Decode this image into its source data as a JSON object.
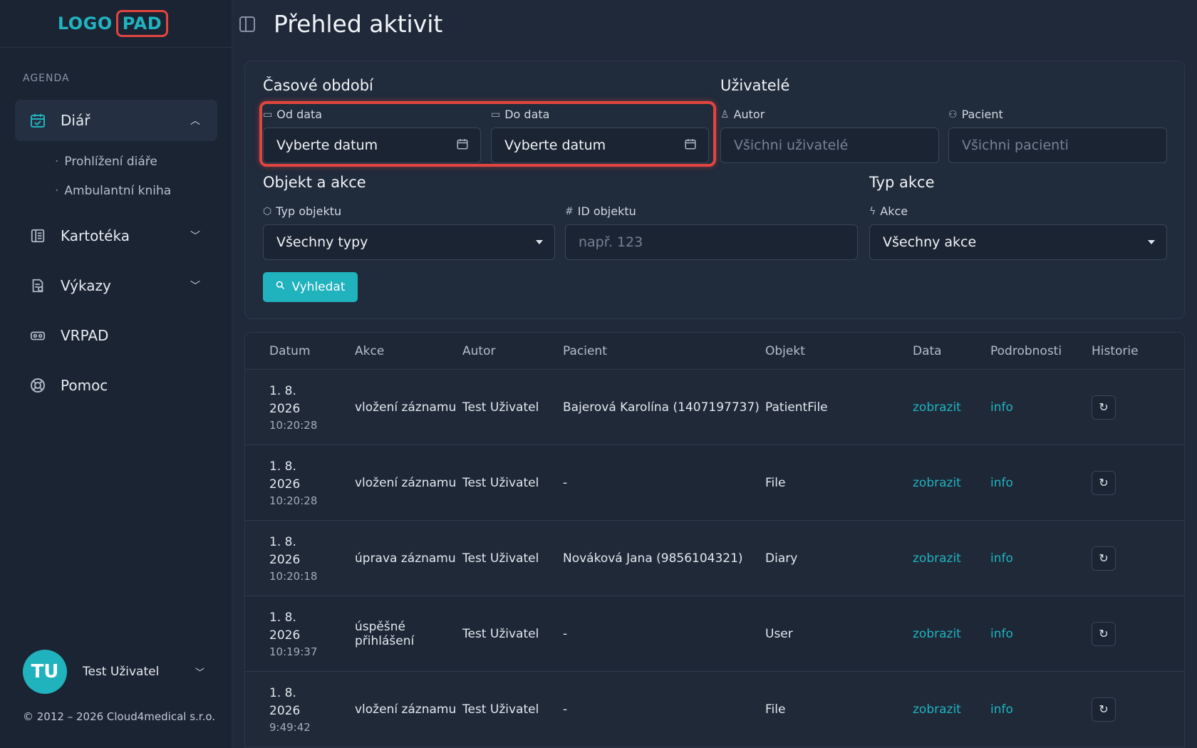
{
  "logo": {
    "part1": "LOGO",
    "part2": "PAD"
  },
  "sidebar": {
    "section_label": "AGENDA",
    "items": [
      {
        "label": "Diář",
        "icon": "calendar-check-icon",
        "expanded": true,
        "sub": [
          {
            "label": "Prohlížení diáře"
          },
          {
            "label": "Ambulantní kniha"
          }
        ]
      },
      {
        "label": "Kartotéka",
        "icon": "file-cabinet-icon"
      },
      {
        "label": "Výkazy",
        "icon": "report-icon"
      },
      {
        "label": "VRPAD",
        "icon": "vr-headset-icon"
      },
      {
        "label": "Pomoc",
        "icon": "lifebuoy-icon"
      }
    ],
    "user": {
      "initials": "TU",
      "name": "Test Uživatel"
    },
    "copyright": "© 2012 – 2026 Cloud4medical s.r.o."
  },
  "header": {
    "title": "Přehled aktivit"
  },
  "filters": {
    "period_title": "Časové období",
    "from_label": "Od data",
    "from_value": "Vyberte datum",
    "to_label": "Do data",
    "to_value": "Vyberte datum",
    "users_title": "Uživatelé",
    "author_label": "Autor",
    "author_placeholder": "Všichni uživatelé",
    "patient_label": "Pacient",
    "patient_placeholder": "Všichni pacienti",
    "object_title": "Objekt a akce",
    "object_type_label": "Typ objektu",
    "object_type_value": "Všechny typy",
    "object_id_label": "ID objektu",
    "object_id_placeholder": "např. 123",
    "action_type_title": "Typ akce",
    "action_label": "Akce",
    "action_value": "Všechny akce",
    "search_label": "Vyhledat"
  },
  "table": {
    "headers": [
      "Datum",
      "Akce",
      "Autor",
      "Pacient",
      "Objekt",
      "Data",
      "Podrobnosti",
      "Historie"
    ],
    "rows": [
      {
        "date": "1. 8. 2026",
        "time": "10:20:28",
        "action": "vložení záznamu",
        "author": "Test Uživatel",
        "patient": "Bajerová Karolína (1407197737)",
        "object": "PatientFile",
        "data": "zobrazit",
        "details": "info"
      },
      {
        "date": "1. 8. 2026",
        "time": "10:20:28",
        "action": "vložení záznamu",
        "author": "Test Uživatel",
        "patient": "-",
        "object": "File",
        "data": "zobrazit",
        "details": "info"
      },
      {
        "date": "1. 8. 2026",
        "time": "10:20:18",
        "action": "úprava záznamu",
        "author": "Test Uživatel",
        "patient": "Nováková Jana (9856104321)",
        "object": "Diary",
        "data": "zobrazit",
        "details": "info"
      },
      {
        "date": "1. 8. 2026",
        "time": "10:19:37",
        "action": "úspěšné přihlášení",
        "author": "Test Uživatel",
        "patient": "-",
        "object": "User",
        "data": "zobrazit",
        "details": "info"
      },
      {
        "date": "1. 8. 2026",
        "time": "9:49:42",
        "action": "vložení záznamu",
        "author": "Test Uživatel",
        "patient": "-",
        "object": "File",
        "data": "zobrazit",
        "details": "info"
      }
    ]
  },
  "colors": {
    "accent": "#20b2bd",
    "highlight": "#e2453f",
    "background": "#1f2939"
  }
}
